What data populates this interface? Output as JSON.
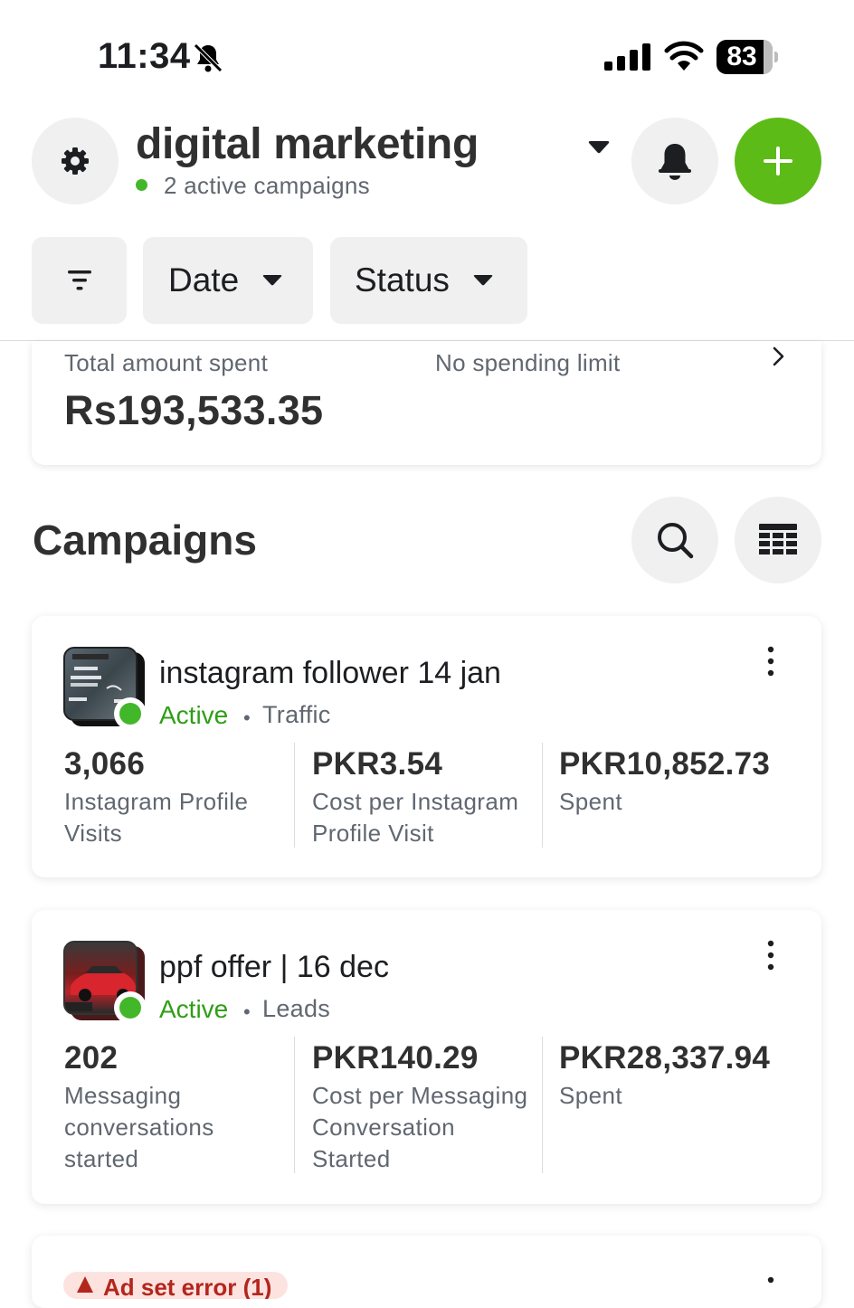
{
  "status_bar": {
    "time": "11:34",
    "battery": "83"
  },
  "header": {
    "account_name": "digital marketing",
    "active_summary": "2 active campaigns",
    "icons": [
      "gear-icon",
      "caret-down-icon",
      "bell-icon",
      "plus-icon"
    ],
    "add_button_color": "#5dbb17",
    "active_dot_color": "#42b72a"
  },
  "filters": {
    "filter_icon": "filter-icon",
    "date_label": "Date",
    "status_label": "Status"
  },
  "spend": {
    "label": "Total amount spent",
    "value": "Rs193,533.35",
    "limit": "No spending limit"
  },
  "campaigns_section": {
    "title": "Campaigns",
    "icons": [
      "search-icon",
      "table-icon"
    ],
    "items": [
      {
        "name": "instagram follower 14 jan",
        "status": "Active",
        "objective": "Traffic",
        "metrics": [
          {
            "value": "3,066",
            "label": "Instagram Profile Visits"
          },
          {
            "value": "PKR3.54",
            "label": "Cost per Instagram Profile Visit"
          },
          {
            "value": "PKR10,852.73",
            "label": "Spent"
          }
        ]
      },
      {
        "name": "ppf offer | 16 dec",
        "status": "Active",
        "objective": "Leads",
        "metrics": [
          {
            "value": "202",
            "label": "Messaging conversations started"
          },
          {
            "value": "PKR140.29",
            "label": "Cost per Messaging Conversation Started"
          },
          {
            "value": "PKR28,337.94",
            "label": "Spent"
          }
        ]
      }
    ],
    "partial_issue_label": "Ad set error (1)"
  },
  "colors": {
    "active_text": "#2e9e16",
    "issue_bg": "#fde3df",
    "issue_text": "#b3261e"
  }
}
